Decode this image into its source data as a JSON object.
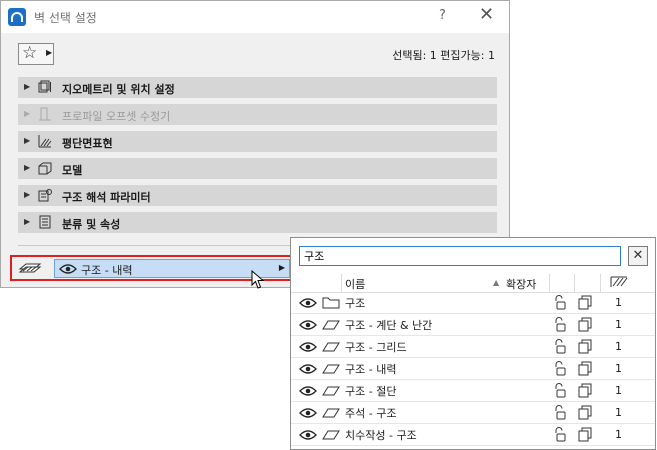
{
  "dialog": {
    "title": "벽 선택 설정",
    "help": "?",
    "close": "✕",
    "selection_info": "선택됨: 1 편집가능: 1"
  },
  "panels": [
    {
      "label": "지오메트리 및 위치 설정",
      "icon": "geometry-icon",
      "disabled": false
    },
    {
      "label": "프로파일 오프셋 수정기",
      "icon": "profile-icon",
      "disabled": true
    },
    {
      "label": "평단면표현",
      "icon": "floor-plan-icon",
      "disabled": false
    },
    {
      "label": "모델",
      "icon": "model-icon",
      "disabled": false
    },
    {
      "label": "구조 해석 파라미터",
      "icon": "structural-icon",
      "disabled": false
    },
    {
      "label": "분류 및 속성",
      "icon": "classification-icon",
      "disabled": false
    }
  ],
  "layer_selector": {
    "current": "구조 - 내력"
  },
  "popup": {
    "search_value": "구조",
    "col_name": "이름",
    "col_ext": "확장자",
    "rows": [
      {
        "name": "구조",
        "type": "folder",
        "num": "1"
      },
      {
        "name": "구조 - 계단 & 난간",
        "type": "layer",
        "num": "1"
      },
      {
        "name": "구조 - 그리드",
        "type": "layer",
        "num": "1"
      },
      {
        "name": "구조 - 내력",
        "type": "layer",
        "num": "1"
      },
      {
        "name": "구조 - 절단",
        "type": "layer",
        "num": "1"
      },
      {
        "name": "주석 - 구조",
        "type": "layer",
        "num": "1"
      },
      {
        "name": "치수작성 - 구조",
        "type": "layer",
        "num": "1"
      }
    ]
  },
  "colors": {
    "accent": "#2b7cd3",
    "highlight": "#e02020",
    "selected_bg": "#c6ddf5"
  }
}
